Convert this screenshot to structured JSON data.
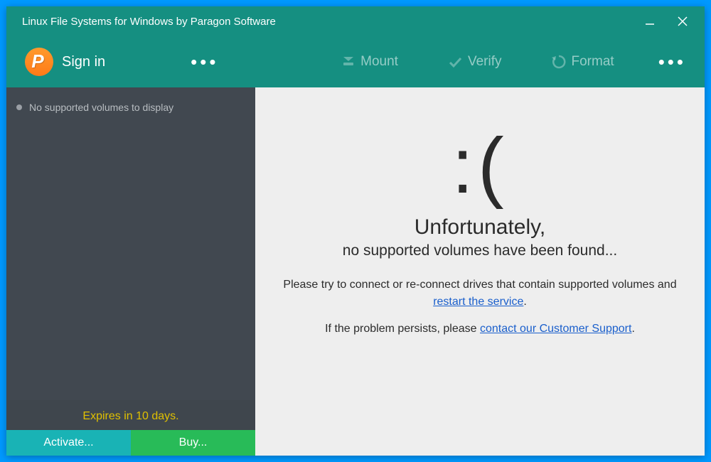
{
  "titlebar": {
    "title": "Linux File Systems for Windows by Paragon Software"
  },
  "toolbar": {
    "signin_label": "Sign in",
    "actions": {
      "mount_label": "Mount",
      "verify_label": "Verify",
      "format_label": "Format"
    }
  },
  "sidebar": {
    "empty_text": "No supported volumes to display",
    "footer": {
      "expires_text": "Expires in 10 days.",
      "activate_label": "Activate...",
      "buy_label": "Buy..."
    }
  },
  "main": {
    "sadface": ":(",
    "heading": "Unfortunately,",
    "subheading": "no supported volumes have been found...",
    "line1_prefix": "Please try to connect or re-connect drives that contain supported volumes and",
    "line1_link": "restart the service",
    "line1_suffix": ".",
    "line2_prefix": "If the problem persists, please ",
    "line2_link": "contact our Customer Support",
    "line2_suffix": "."
  }
}
